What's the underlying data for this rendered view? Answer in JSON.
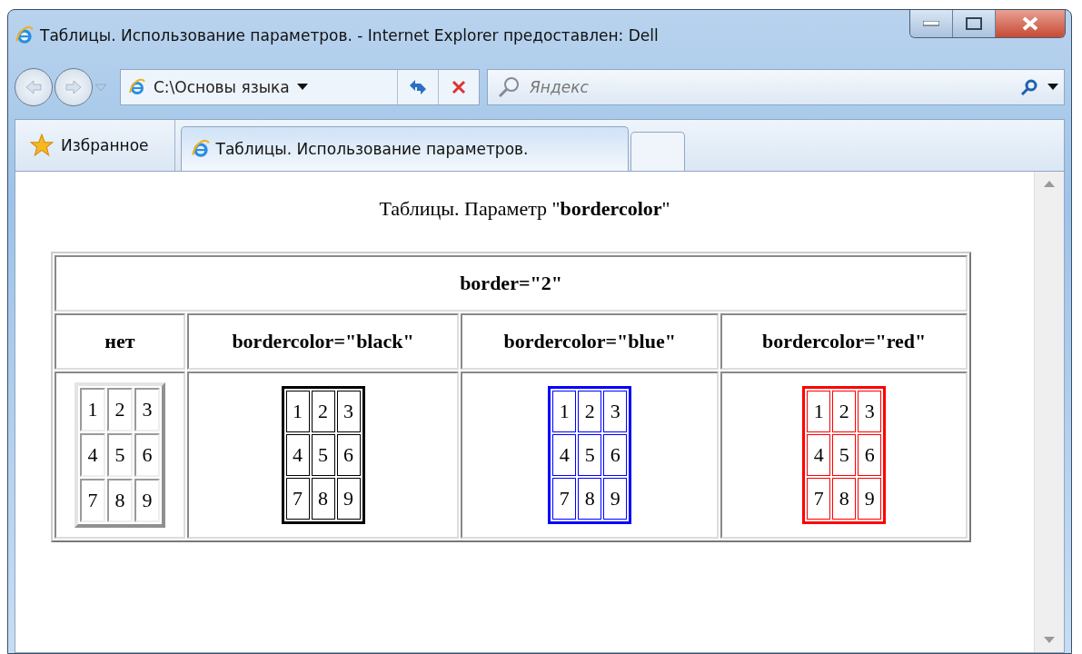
{
  "window": {
    "title": "Таблицы. Использование параметров. - Internet Explorer предоставлен: Dell"
  },
  "address_bar": {
    "value": "C:\\Основы языка"
  },
  "search": {
    "placeholder": "Яндекс"
  },
  "favorites": {
    "label": "Избранное"
  },
  "tabs": [
    {
      "label": "Таблицы. Использование параметров.",
      "selected": true
    }
  ],
  "page": {
    "heading": "Таблицы. Параметр \"**bordercolor**\"",
    "table": {
      "caption_row": "border=\"2\"",
      "columns": [
        {
          "header": "нет",
          "sample": {
            "kind": "default",
            "cells": [
              [
                "1",
                "2",
                "3"
              ],
              [
                "4",
                "5",
                "6"
              ],
              [
                "7",
                "8",
                "9"
              ]
            ]
          }
        },
        {
          "header": "bordercolor=\"black\"",
          "sample": {
            "kind": "colored",
            "color": "#000000",
            "cells": [
              [
                "1",
                "2",
                "3"
              ],
              [
                "4",
                "5",
                "6"
              ],
              [
                "7",
                "8",
                "9"
              ]
            ]
          }
        },
        {
          "header": "bordercolor=\"blue\"",
          "sample": {
            "kind": "colored",
            "color": "#0000ff",
            "cells": [
              [
                "1",
                "2",
                "3"
              ],
              [
                "4",
                "5",
                "6"
              ],
              [
                "7",
                "8",
                "9"
              ]
            ]
          }
        },
        {
          "header": "bordercolor=\"red\"",
          "sample": {
            "kind": "colored",
            "color": "#ff0000",
            "cells": [
              [
                "1",
                "2",
                "3"
              ],
              [
                "4",
                "5",
                "6"
              ],
              [
                "7",
                "8",
                "9"
              ]
            ]
          }
        }
      ]
    }
  }
}
